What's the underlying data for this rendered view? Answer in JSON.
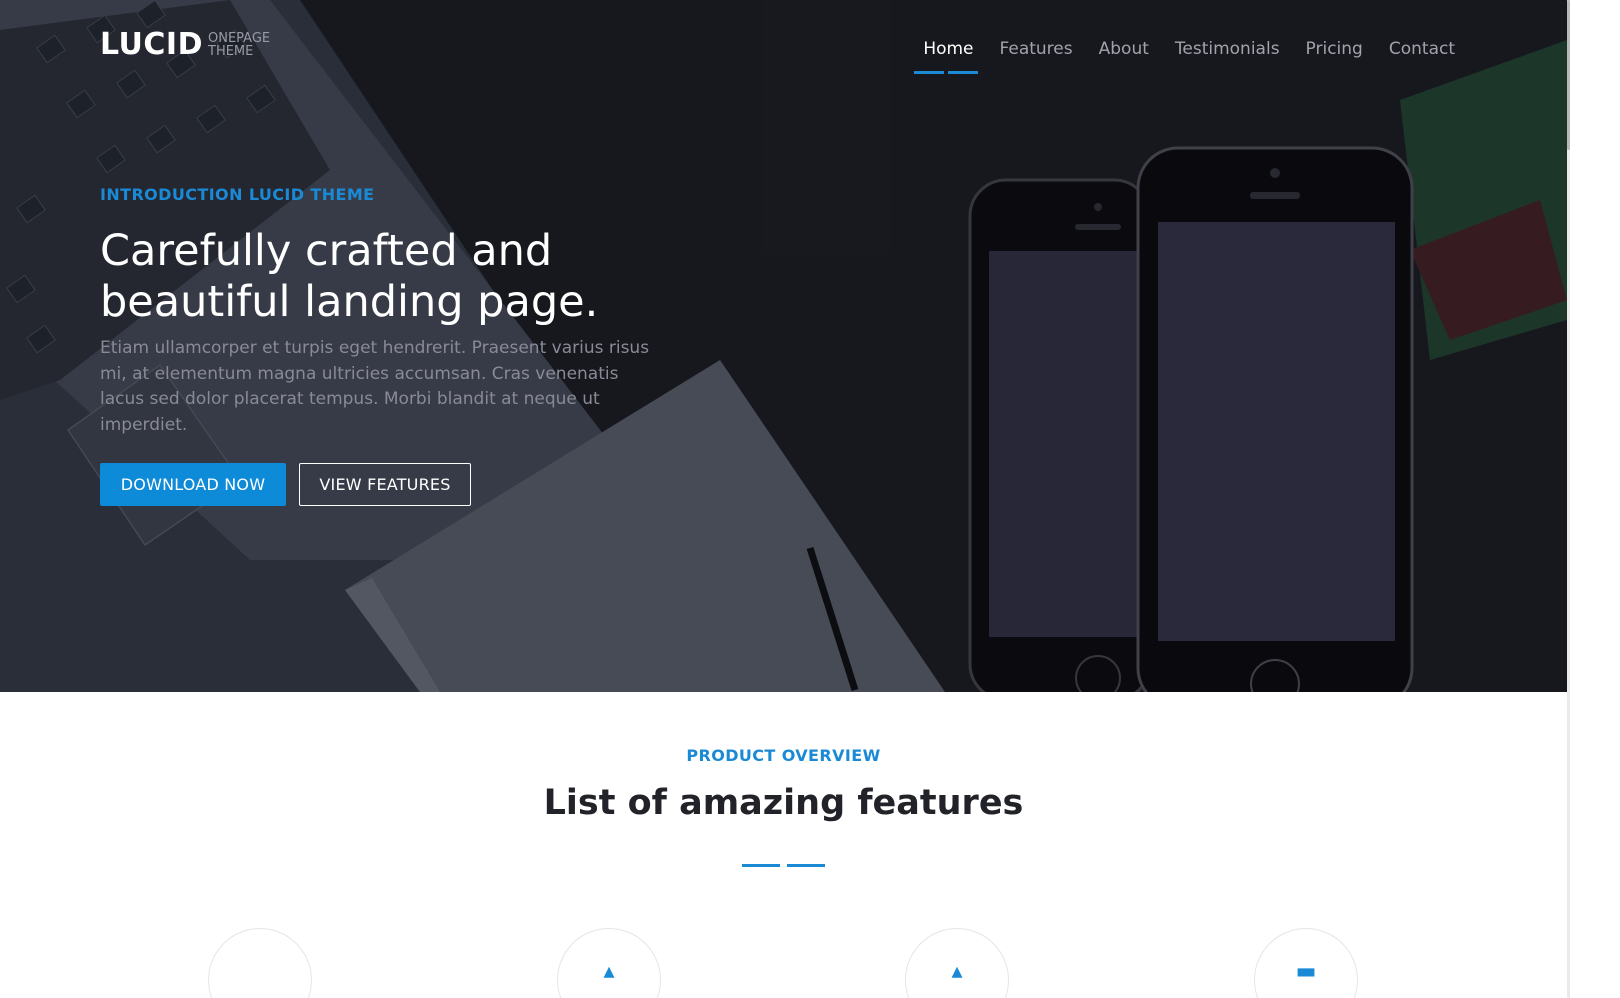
{
  "brand": {
    "name": "LUCID",
    "sub_line1": "ONEPAGE",
    "sub_line2": "THEME"
  },
  "nav": {
    "items": [
      {
        "label": "Home",
        "active": true
      },
      {
        "label": "Features",
        "active": false
      },
      {
        "label": "About",
        "active": false
      },
      {
        "label": "Testimonials",
        "active": false
      },
      {
        "label": "Pricing",
        "active": false
      },
      {
        "label": "Contact",
        "active": false
      }
    ]
  },
  "hero": {
    "eyebrow": "INTRODUCTION LUCID THEME",
    "headline_line1": "Carefully crafted and",
    "headline_line2": "beautiful landing page.",
    "lead": "Etiam ullamcorper et turpis eget hendrerit. Praesent varius risus mi, at elementum magna ultricies accumsan. Cras venenatis lacus sed dolor placerat tempus. Morbi blandit at neque ut imperdiet.",
    "primary_button": "DOWNLOAD NOW",
    "secondary_button": "VIEW FEATURES"
  },
  "features": {
    "eyebrow": "PRODUCT OVERVIEW",
    "title": "List of amazing features",
    "icons": [
      "feature-icon-1",
      "feature-icon-2",
      "feature-icon-3",
      "feature-icon-4"
    ]
  },
  "colors": {
    "accent": "#1a8ad6",
    "button_primary": "#0d8ad8",
    "hero_dark": "#1a1b22",
    "title_text": "#222328"
  }
}
